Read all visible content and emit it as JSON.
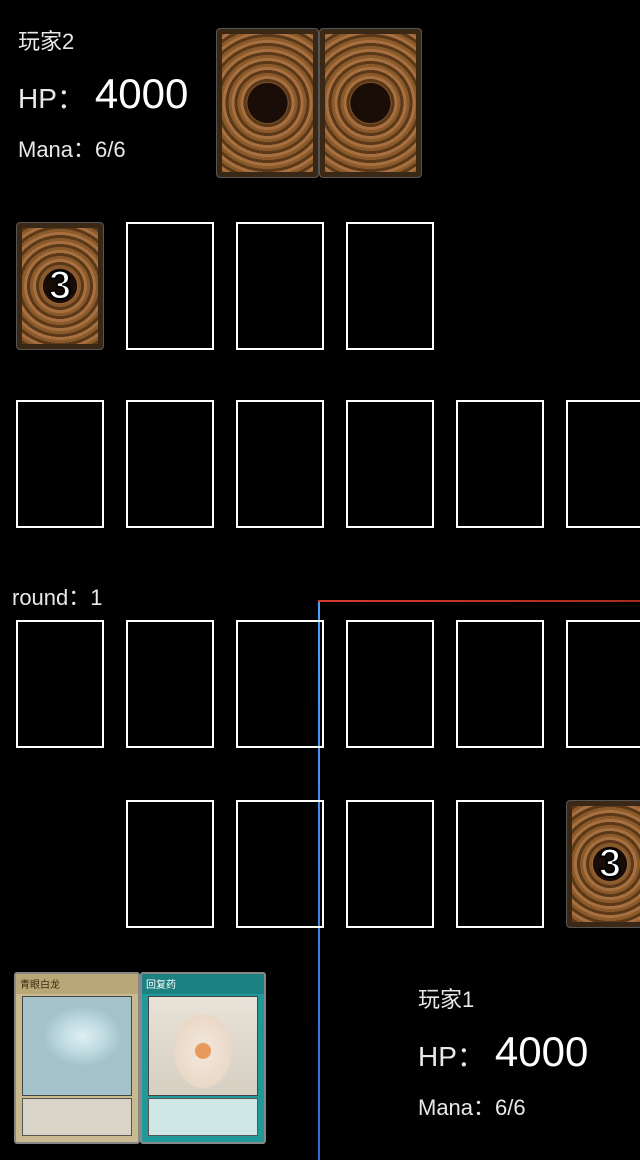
{
  "opponent": {
    "label": "玩家2",
    "hp_label": "HP：",
    "hp_value": "4000",
    "mana_label": "Mana：",
    "mana_value": "6/6",
    "hand_count": 2,
    "deck_count": "3"
  },
  "player": {
    "label": "玩家1",
    "hp_label": "HP：",
    "hp_value": "4000",
    "mana_label": "Mana：",
    "mana_value": "6/6",
    "deck_count": "3",
    "hand": [
      {
        "type": "monster",
        "name": "青眼白龙"
      },
      {
        "type": "spell",
        "name": "回复药"
      }
    ]
  },
  "round": {
    "label": "round：",
    "value": "1"
  }
}
